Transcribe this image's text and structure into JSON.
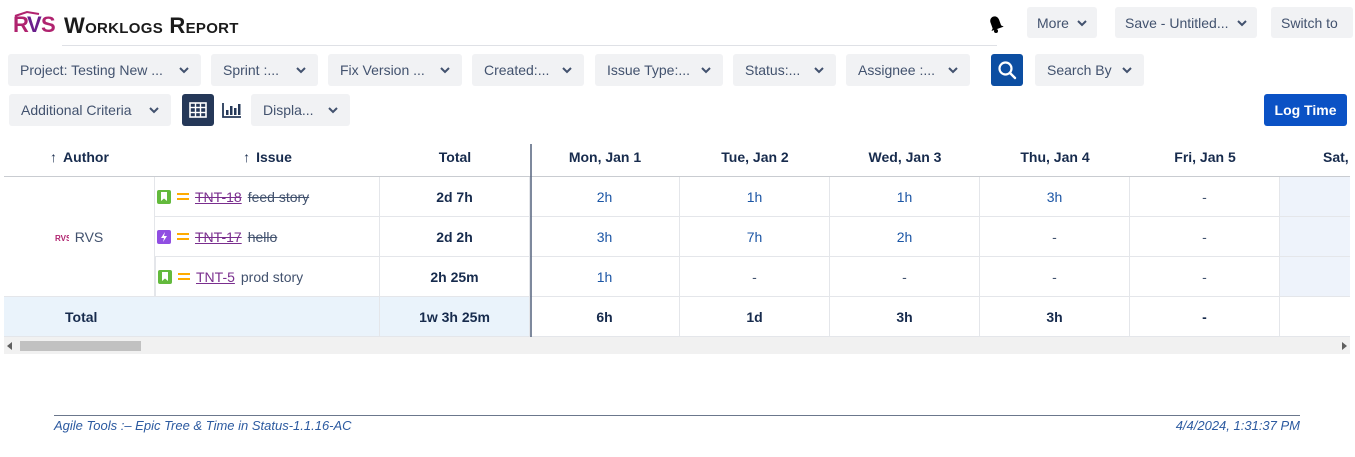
{
  "app": {
    "title": "Worklogs Report"
  },
  "header": {
    "more_label": "More",
    "save_label": "Save - Untitled...",
    "switch_label": "Switch to"
  },
  "filters": {
    "project": "Project: Testing New ...",
    "sprint": "Sprint :...",
    "fix_version": "Fix Version ...",
    "created": "Created:...",
    "issue_type": "Issue Type:...",
    "status": "Status:...",
    "assignee": "Assignee :...",
    "search_by": "Search By",
    "additional_criteria": "Additional Criteria",
    "display": "Displa..."
  },
  "actions": {
    "log_time": "Log Time"
  },
  "table": {
    "headers": {
      "author": "Author",
      "issue": "Issue",
      "total": "Total",
      "days": [
        "Mon, Jan 1",
        "Tue, Jan 2",
        "Wed, Jan 3",
        "Thu, Jan 4",
        "Fri, Jan 5",
        "Sat,"
      ]
    },
    "author": {
      "name": "RVS"
    },
    "rows": [
      {
        "key": "TNT-18",
        "summary": "feed story",
        "type": "story",
        "done": true,
        "total": "2d 7h",
        "days": [
          "2h",
          "1h",
          "1h",
          "3h",
          "-",
          ""
        ]
      },
      {
        "key": "TNT-17",
        "summary": "hello",
        "type": "epic",
        "done": true,
        "total": "2d 2h",
        "days": [
          "3h",
          "7h",
          "2h",
          "-",
          "-",
          ""
        ]
      },
      {
        "key": "TNT-5",
        "summary": "prod story",
        "type": "story",
        "done": false,
        "total": "2h 25m",
        "days": [
          "1h",
          "-",
          "-",
          "-",
          "-",
          ""
        ]
      }
    ],
    "totals": {
      "label": "Total",
      "total": "1w 3h 25m",
      "days": [
        "6h",
        "1d",
        "3h",
        "3h",
        "-",
        ""
      ]
    }
  },
  "footer": {
    "version": "Agile Tools :– Epic Tree & Time in Status-1.1.16-AC",
    "timestamp": "4/4/2024, 1:31:37 PM"
  },
  "colors": {
    "primary": "#0b52c5",
    "search": "#0c4ea2",
    "link": "#1c56a5",
    "issue_key": "#7a2e8e",
    "story": "#63ba3c",
    "epic": "#904ee2",
    "priority": "#ffab00"
  }
}
